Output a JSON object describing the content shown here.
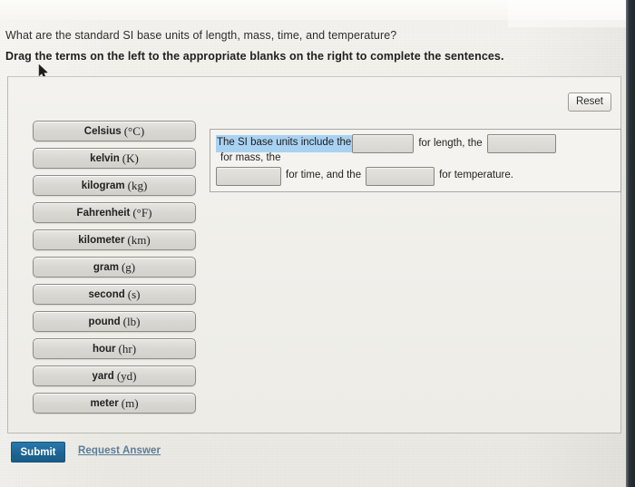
{
  "question": {
    "prompt": "What are the standard SI base units of length, mass, time, and temperature?",
    "instruction": "Drag the terms on the left to the appropriate blanks on the right to complete the sentences."
  },
  "panel": {
    "reset_label": "Reset"
  },
  "terms": [
    {
      "name": "Celsius",
      "symbol": "(°C)"
    },
    {
      "name": "kelvin",
      "symbol": "(K)"
    },
    {
      "name": "kilogram",
      "symbol": "(kg)"
    },
    {
      "name": "Fahrenheit",
      "symbol": "(°F)"
    },
    {
      "name": "kilometer",
      "symbol": "(km)"
    },
    {
      "name": "gram",
      "symbol": "(g)"
    },
    {
      "name": "second",
      "symbol": "(s)"
    },
    {
      "name": "pound",
      "symbol": "(lb)"
    },
    {
      "name": "hour",
      "symbol": "(hr)"
    },
    {
      "name": "yard",
      "symbol": "(yd)"
    },
    {
      "name": "meter",
      "symbol": "(m)"
    }
  ],
  "sentence": {
    "selected_text": "The SI base units include the",
    "after_blank1": "for length, the",
    "after_blank2": "for mass, the",
    "after_blank3": "for time, and the",
    "after_blank4": "for temperature.",
    "blank1_value": "",
    "blank2_value": "",
    "blank3_value": "",
    "blank4_value": ""
  },
  "footer": {
    "submit_label": "Submit",
    "request_answer_label": "Request Answer"
  },
  "colors": {
    "selection_highlight": "#a9d2f2",
    "submit_blue": "#1d6391",
    "link_blue": "#5b7c99",
    "term_gray": "#d8d7d1",
    "page_background": "#eeede7"
  }
}
